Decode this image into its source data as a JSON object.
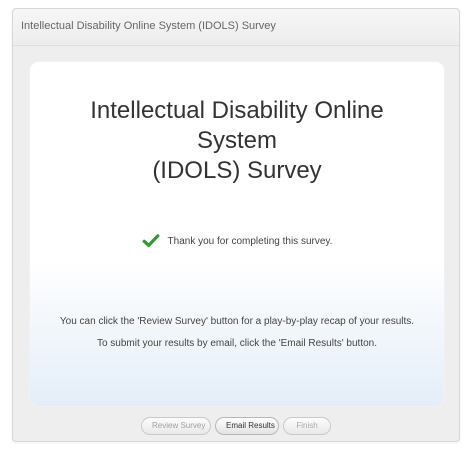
{
  "window": {
    "title": "Intellectual Disability Online System (IDOLS) Survey"
  },
  "main": {
    "heading_line_1": "Intellectual Disability Online System",
    "heading_line_2": "(IDOLS) Survey",
    "completion_message": "Thank you for completing this survey.",
    "instruction_line_1": "You can click the 'Review Survey' button for a play-by-play recap of your results.",
    "instruction_line_2": "To submit your results by email, click the 'Email Results' button."
  },
  "buttons": {
    "review_label": "Review Survey",
    "email_label": "Email Results",
    "finish_label": "Finish"
  },
  "icons": {
    "completion": "check-icon"
  },
  "colors": {
    "check": "#2f9b2f",
    "title_text": "#666666",
    "heading_text": "#333333"
  }
}
